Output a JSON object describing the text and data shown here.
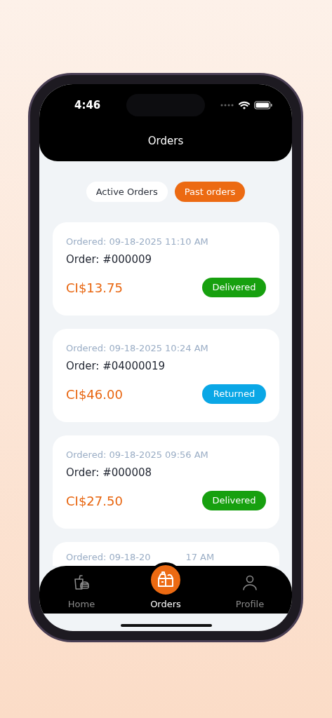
{
  "status_bar": {
    "time": "4:46"
  },
  "header": {
    "title": "Orders"
  },
  "segments": [
    {
      "label": "Active Orders",
      "selected": false
    },
    {
      "label": "Past orders",
      "selected": true
    }
  ],
  "orders": [
    {
      "date": "Ordered: 09-18-2025 11:10 AM",
      "number": "Order: #000009",
      "amount": "CI$13.75",
      "status": "Delivered",
      "kind": "delivered"
    },
    {
      "date": "Ordered: 09-18-2025 10:24 AM",
      "number": "Order: #04000019",
      "amount": "CI$46.00",
      "status": "Returned",
      "kind": "returned"
    },
    {
      "date": "Ordered: 09-18-2025 09:56 AM",
      "number": "Order: #000008",
      "amount": "CI$27.50",
      "status": "Delivered",
      "kind": "delivered"
    }
  ],
  "partial_order": {
    "date_start": "Ordered: 09-18-20",
    "date_end": "17 AM"
  },
  "tab_bar": [
    {
      "label": "Home",
      "selected": false
    },
    {
      "label": "Orders",
      "selected": true
    },
    {
      "label": "Profile",
      "selected": false
    }
  ]
}
